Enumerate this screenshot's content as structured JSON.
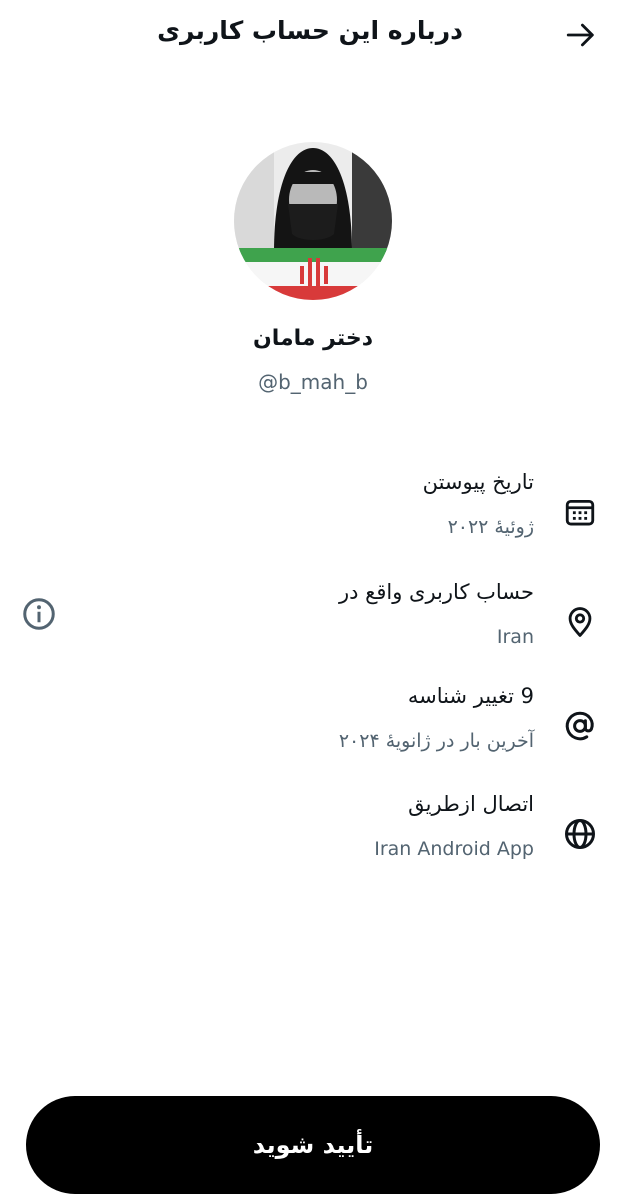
{
  "header": {
    "title": "درباره این حساب کاربری",
    "back_icon": "arrow-right-icon"
  },
  "profile": {
    "display_name": "دختر مامان",
    "username": "@b_mah_b"
  },
  "info_rows": [
    {
      "title": "تاریخ پیوستن",
      "subtitle": "ژوئیهٔ ۲۰۲۲",
      "icon": "calendar-icon"
    },
    {
      "title": "حساب کاربری واقع در",
      "subtitle": "Iran",
      "icon": "location-pin-icon"
    },
    {
      "title": "9 تغییر شناسه",
      "subtitle": "آخرین بار در ژانویهٔ ۲۰۲۴",
      "icon": "at-sign-icon"
    },
    {
      "title": "اتصال ازطریق",
      "subtitle": "Iran Android App",
      "icon": "globe-icon"
    }
  ],
  "footer": {
    "verify_label": "تأیید شوید"
  },
  "colors": {
    "text": "#0f1419",
    "secondary_text": "#536471",
    "button_bg": "#000000",
    "button_text": "#ffffff"
  }
}
